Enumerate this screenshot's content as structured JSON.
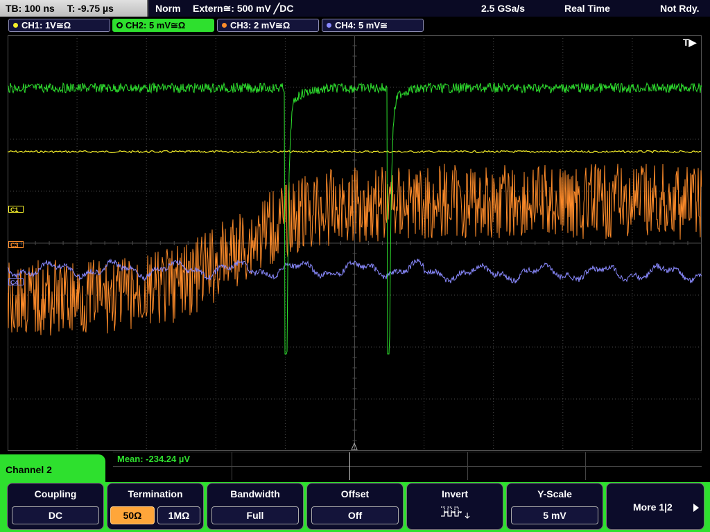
{
  "status_bar": {
    "timebase": "TB: 100 ns",
    "trigger_time": "T: -9.75 µs",
    "mode": "Norm",
    "trigger": "Extern≅: 500 mV ╱DC",
    "sample_rate": "2.5 GSa/s",
    "acq_mode": "Real Time",
    "ready": "Not Rdy."
  },
  "channels": [
    {
      "label": "CH1: 1V≅Ω",
      "color": "#f6f02a"
    },
    {
      "label": "CH2: 5 mV≅Ω",
      "color": "#2ee02e"
    },
    {
      "label": "CH3: 2 mV≅Ω",
      "color": "#ff8c2a"
    },
    {
      "label": "CH4: 5 mV≅",
      "color": "#8a8aff"
    }
  ],
  "markers": {
    "c1": "C1",
    "c3": "C3",
    "c4": "C4",
    "trigger_tag": "T▶"
  },
  "measurement": {
    "mean": "Mean: -234.24 µV"
  },
  "menu": {
    "title": "Channel 2",
    "coupling": {
      "label": "Coupling",
      "value": "DC"
    },
    "termination": {
      "label": "Termination",
      "opt1": "50Ω",
      "opt2": "1MΩ"
    },
    "bandwidth": {
      "label": "Bandwidth",
      "value": "Full"
    },
    "offset": {
      "label": "Offset",
      "value": "Off"
    },
    "invert": {
      "label": "Invert",
      "icon": "square-wave-invert-icon"
    },
    "y_scale": {
      "label": "Y-Scale",
      "value": "5 mV"
    },
    "more": {
      "label": "More 1|2",
      "icon": "triangle-right-icon"
    }
  }
}
